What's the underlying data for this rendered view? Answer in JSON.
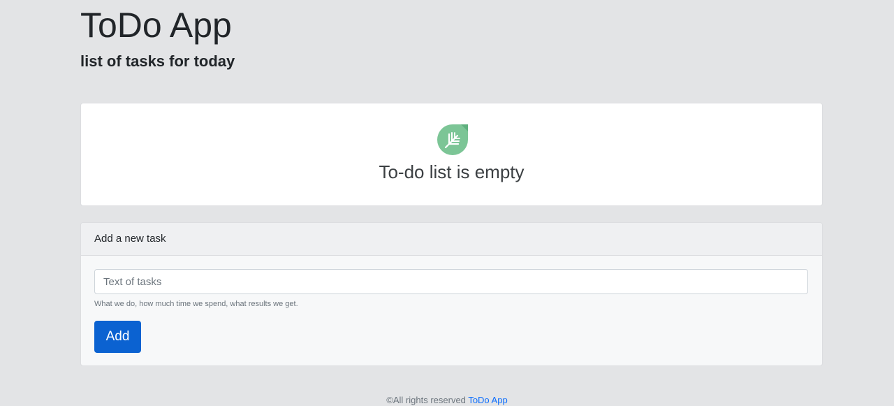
{
  "header": {
    "title": "ToDo App",
    "subtitle": "list of tasks for today"
  },
  "empty_state": {
    "icon": "leaf-icon",
    "message": "To-do list is empty"
  },
  "add_task": {
    "header_title": "Add a new task",
    "input_value": "",
    "input_placeholder": "Text of tasks",
    "help_text": "What we do, how much time we spend, what results we get.",
    "button_label": "Add"
  },
  "footer": {
    "copyright": "©All rights reserved",
    "link_text": "ToDo App"
  },
  "colors": {
    "background": "#e3e4e6",
    "primary": "#0b62d1",
    "leaf_green": "#7cc596",
    "link": "#0d6efd"
  }
}
